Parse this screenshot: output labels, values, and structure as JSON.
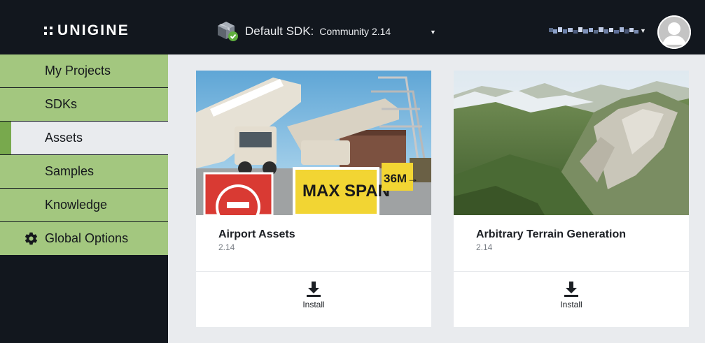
{
  "header": {
    "logo_text": "UNIGINE",
    "sdk_label": "Default SDK:",
    "sdk_value": "Community 2.14",
    "sdk_icon": "package-check-icon",
    "user_avatar_icon": "user-avatar-icon"
  },
  "sidebar": {
    "items": [
      {
        "label": "My Projects"
      },
      {
        "label": "SDKs"
      },
      {
        "label": "Assets",
        "active": true
      },
      {
        "label": "Samples"
      },
      {
        "label": "Knowledge"
      },
      {
        "label": "Global Options",
        "icon": "gear-icon"
      }
    ]
  },
  "cards": [
    {
      "title": "Airport Assets",
      "version": "2.14",
      "action": "Install"
    },
    {
      "title": "Arbitrary Terrain Generation",
      "version": "2.14",
      "action": "Install"
    }
  ],
  "colors": {
    "nav_green": "#a3c77f",
    "nav_active_marker": "#78a94d",
    "topbar": "#12171e",
    "content_bg": "#e9ebee"
  }
}
